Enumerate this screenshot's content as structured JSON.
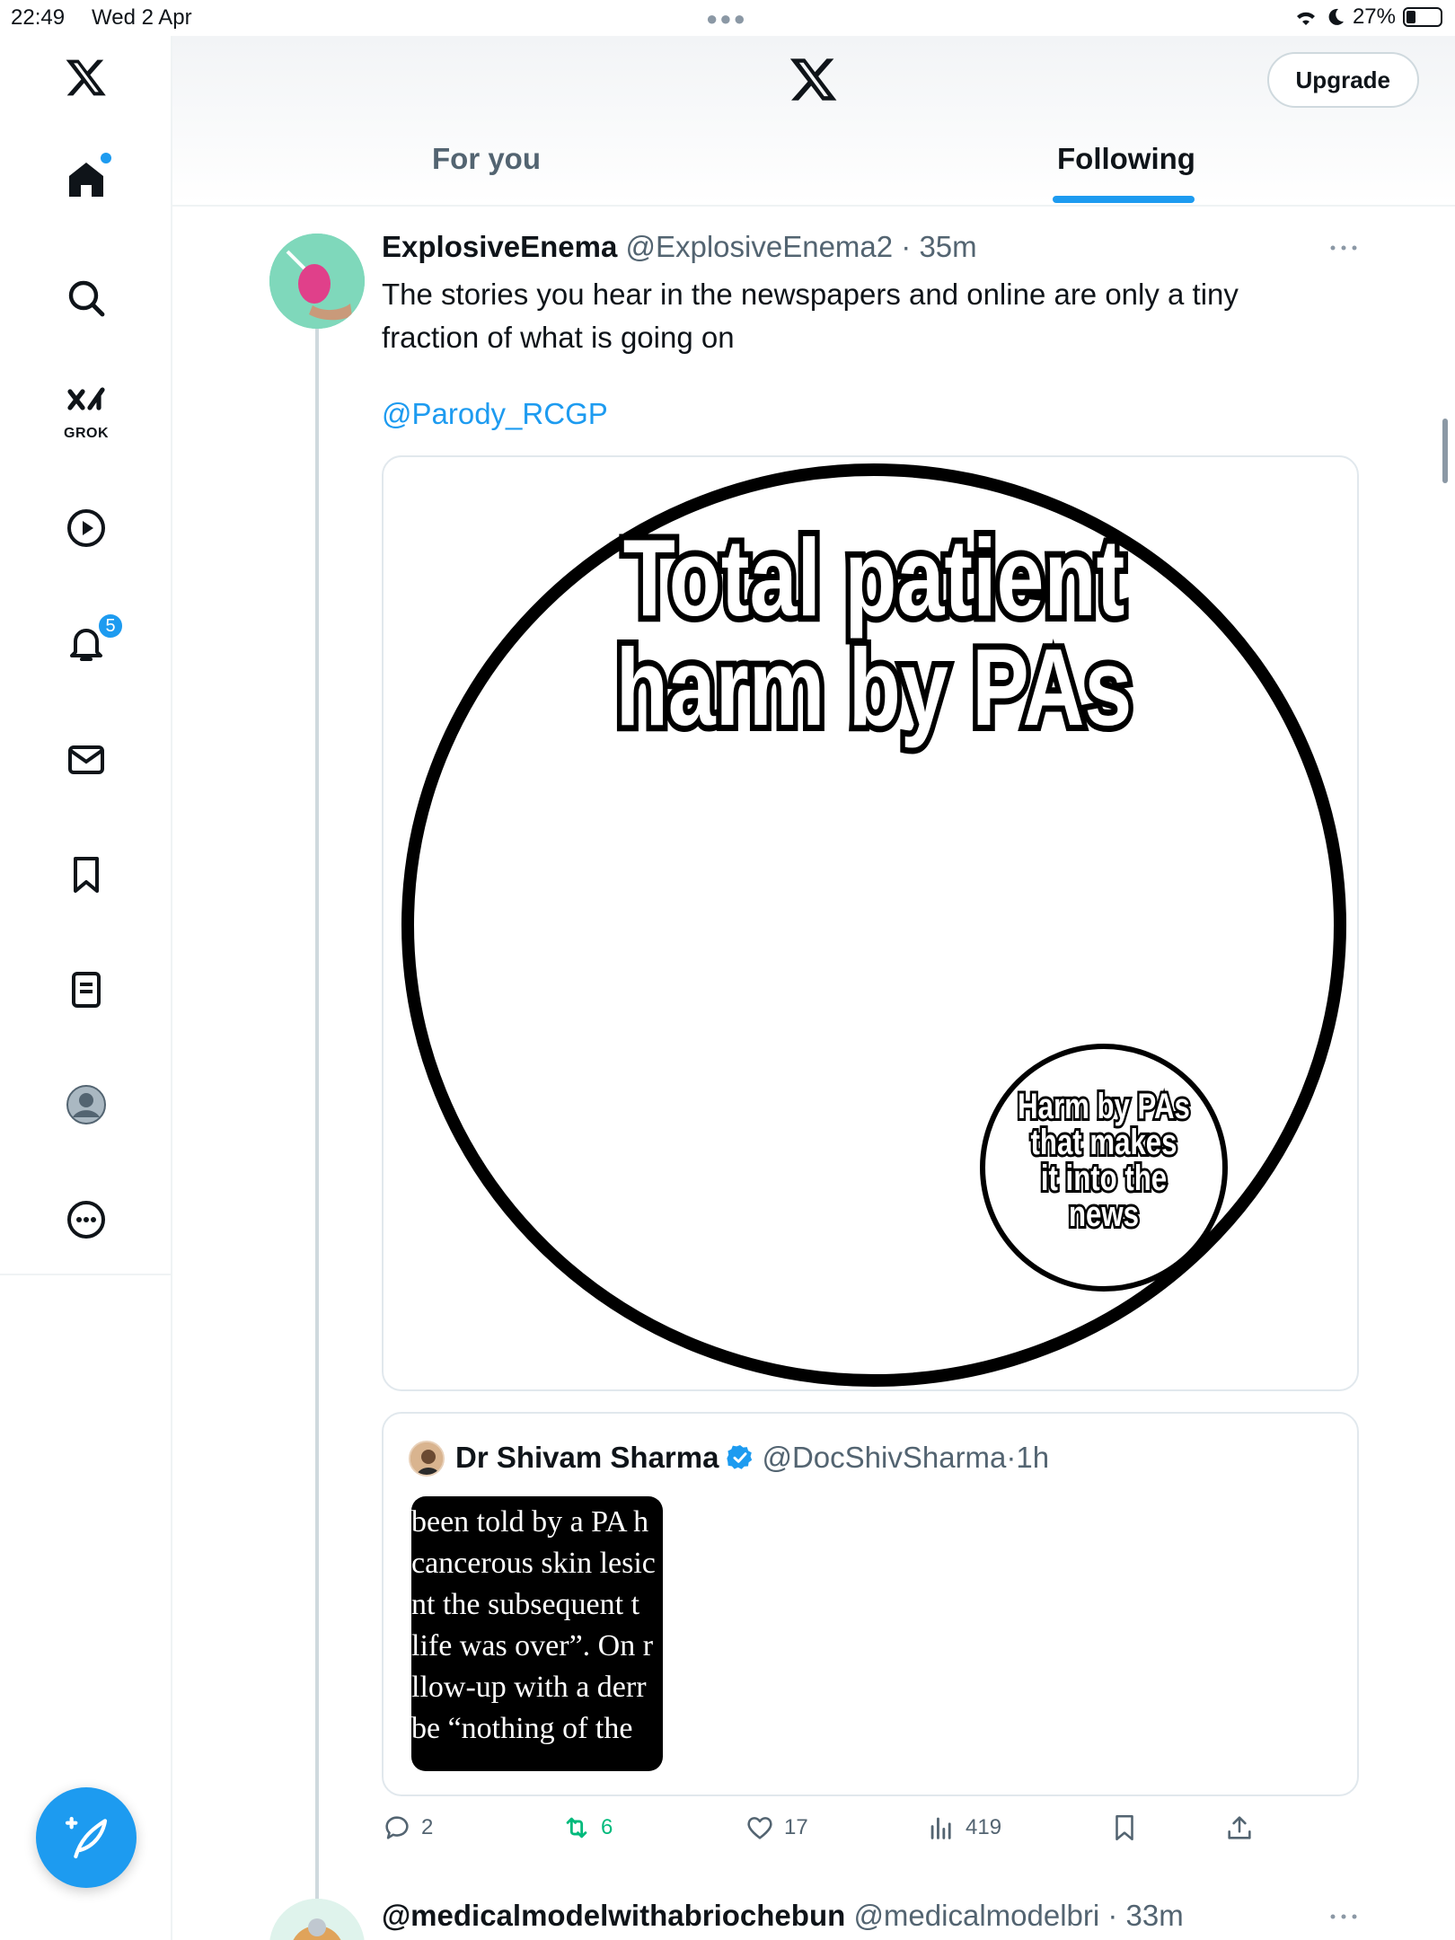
{
  "status_bar": {
    "time": "22:49",
    "date": "Wed 2 Apr",
    "battery": "27%"
  },
  "sidebar": {
    "grok_label": "GROK",
    "notifications_count": "5"
  },
  "header": {
    "upgrade_label": "Upgrade",
    "tabs": [
      {
        "label": "For you",
        "active": false
      },
      {
        "label": "Following",
        "active": true
      }
    ]
  },
  "tweet": {
    "name": "ExplosiveEnema",
    "handle": "@ExplosiveEnema2",
    "separator": " · ",
    "time": "35m",
    "text": "The stories you hear in the newspapers and online are only a tiny fraction of what is going on",
    "mention": "@Parody_RCGP",
    "image": {
      "big_circle_line1": "Total patient",
      "big_circle_line2": "harm by PAs",
      "small_circle_lines": [
        "Harm by PAs",
        "that makes",
        "it into the",
        "news"
      ]
    },
    "quote": {
      "name": "Dr Shivam Sharma",
      "handle": "@DocShivSharma",
      "separator": " · ",
      "time": "1h",
      "image_text_lines": [
        " been told by a PA h",
        "cancerous skin lesic",
        "nt the subsequent t",
        " life was over”. On r",
        "llow-up with a derr",
        "be “nothing of the"
      ]
    },
    "actions": {
      "replies": "2",
      "reposts": "6",
      "likes": "17",
      "views": "419"
    }
  },
  "next_tweet": {
    "name": "@medicalmodelwithabriochebun",
    "handle": "@medicalmodelbri",
    "separator": " · ",
    "time": "33m"
  },
  "colors": {
    "accent": "#1d9bf0",
    "repost": "#00ba7c",
    "secondary_text": "#536471"
  }
}
